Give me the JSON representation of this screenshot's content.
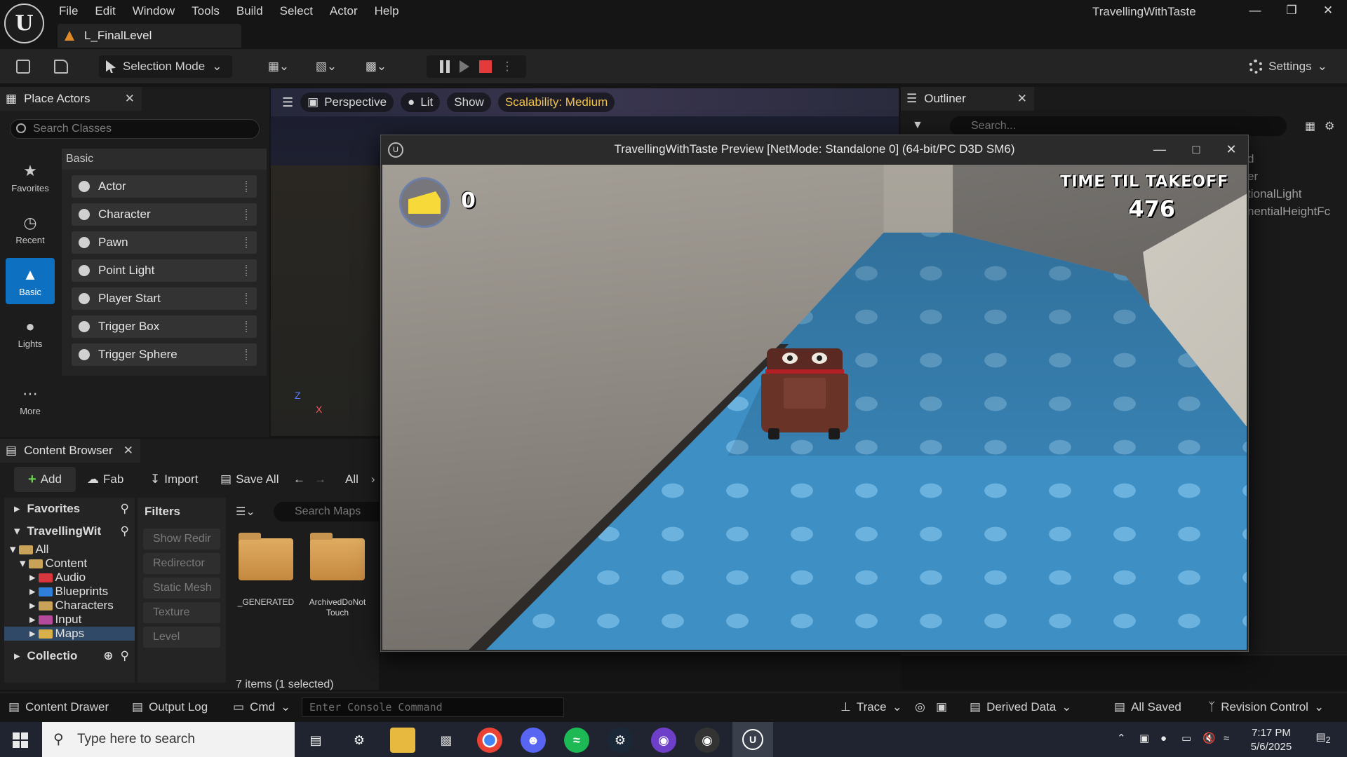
{
  "window": {
    "app_title": "TravellingWithTaste",
    "level_tab": "L_FinalLevel",
    "menu": [
      "File",
      "Edit",
      "Window",
      "Tools",
      "Build",
      "Select",
      "Actor",
      "Help"
    ]
  },
  "toolbar": {
    "selection_mode": "Selection Mode",
    "settings": "Settings"
  },
  "place_actors": {
    "title": "Place Actors",
    "search_placeholder": "Search Classes",
    "categories": [
      {
        "label": "Favorites",
        "icon": "star-icon"
      },
      {
        "label": "Recent",
        "icon": "clock-icon"
      },
      {
        "label": "Basic",
        "icon": "shapes-icon",
        "active": true
      },
      {
        "label": "Lights",
        "icon": "bulb-icon"
      },
      {
        "label": "More",
        "icon": "more-icon"
      }
    ],
    "group_header": "Basic",
    "items": [
      "Actor",
      "Character",
      "Pawn",
      "Point Light",
      "Player Start",
      "Trigger Box",
      "Trigger Sphere"
    ]
  },
  "viewport": {
    "perspective": "Perspective",
    "lit": "Lit",
    "show": "Show",
    "scalability": "Scalability: Medium",
    "axis_z": "Z",
    "axis_x": "X"
  },
  "outliner": {
    "title": "Outliner",
    "search_placeholder": "Search...",
    "rows": [
      "d",
      "er",
      "tionalLight",
      "nentialHeightFc"
    ]
  },
  "content_browser": {
    "title": "Content Browser",
    "add": "Add",
    "fab": "Fab",
    "import": "Import",
    "save_all": "Save All",
    "path_all": "All",
    "favorites": "Favorites",
    "project": "TravellingWit",
    "tree": [
      {
        "label": "All",
        "level": 0,
        "color": "#c9a25a"
      },
      {
        "label": "Content",
        "level": 1,
        "color": "#c9a25a"
      },
      {
        "label": "Audio",
        "level": 2,
        "color": "#d9363e"
      },
      {
        "label": "Blueprints",
        "level": 2,
        "color": "#2f7fd8"
      },
      {
        "label": "Characters",
        "level": 2,
        "color": "#c9a25a"
      },
      {
        "label": "Input",
        "level": 2,
        "color": "#b44a9a"
      },
      {
        "label": "Maps",
        "level": 2,
        "color": "#d8b049",
        "selected": true
      }
    ],
    "collections": "Collectio",
    "filters_title": "Filters",
    "filters": [
      "Show Redir",
      "Redirector",
      "Static Mesh",
      "Texture",
      "Level"
    ],
    "search_placeholder": "Search Maps",
    "folders": [
      "_GENERATED",
      "ArchivedDoNot Touch"
    ],
    "items_count": "7 items (1 selected)"
  },
  "preview": {
    "title": "TravellingWithTaste Preview [NetMode: Standalone 0]  (64-bit/PC D3D SM6)",
    "cheese_count": "0",
    "timer_label": "TIME TIL TAKEOFF",
    "timer_value": "476"
  },
  "statusbar": {
    "content_drawer": "Content Drawer",
    "output_log": "Output Log",
    "cmd": "Cmd",
    "console_placeholder": "Enter Console Command",
    "trace": "Trace",
    "derived_data": "Derived Data",
    "all_saved": "All Saved",
    "revision_control": "Revision Control"
  },
  "taskbar": {
    "search_placeholder": "Type here to search",
    "time": "7:17 PM",
    "date": "5/6/2025",
    "notifications": "2"
  }
}
